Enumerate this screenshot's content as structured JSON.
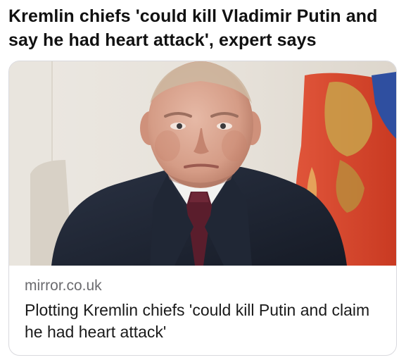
{
  "post": {
    "title": "Kremlin chiefs 'could kill Vladimir Putin and say he had heart attack', expert says"
  },
  "card": {
    "source": "mirror.co.uk",
    "headline": "Plotting Kremlin chiefs 'could kill Putin and claim he had heart attack'",
    "image_subject": "photo of a man in a dark suit and burgundy tie in front of a red flag"
  },
  "colors": {
    "flag_red": "#d8432a",
    "flag_gold": "#c9a24a",
    "suit": "#1f2634",
    "tie": "#5a1d2c",
    "source_text": "#6b6b6f"
  }
}
